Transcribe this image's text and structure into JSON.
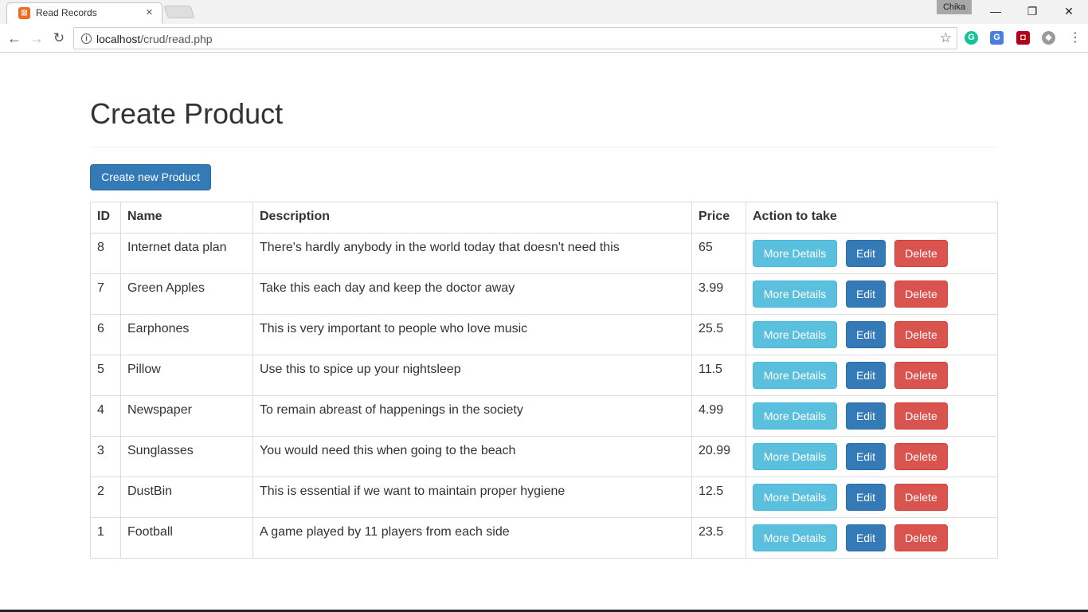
{
  "browser": {
    "tab_title": "Read Records",
    "tab_close": "×",
    "profile_name": "Chika",
    "url_host": "localhost",
    "url_path": "/crud/read.php",
    "window": {
      "minimize": "—",
      "restore": "❐",
      "close": "✕"
    }
  },
  "page": {
    "title": "Create Product",
    "create_button": "Create new Product"
  },
  "table": {
    "headers": {
      "id": "ID",
      "name": "Name",
      "description": "Description",
      "price": "Price",
      "actions": "Action to take"
    },
    "actions": {
      "details": "More Details",
      "edit": "Edit",
      "delete": "Delete"
    },
    "rows": [
      {
        "id": "8",
        "name": "Internet data plan",
        "description": "There's hardly anybody in the world today that doesn't need this",
        "price": "65"
      },
      {
        "id": "7",
        "name": "Green Apples",
        "description": "Take this each day and keep the doctor away",
        "price": "3.99"
      },
      {
        "id": "6",
        "name": "Earphones",
        "description": "This is very important to people who love music",
        "price": "25.5"
      },
      {
        "id": "5",
        "name": "Pillow",
        "description": "Use this to spice up your nightsleep",
        "price": "11.5"
      },
      {
        "id": "4",
        "name": "Newspaper",
        "description": "To remain abreast of happenings in the society",
        "price": "4.99"
      },
      {
        "id": "3",
        "name": "Sunglasses",
        "description": "You would need this when going to the beach",
        "price": "20.99"
      },
      {
        "id": "2",
        "name": "DustBin",
        "description": "This is essential if we want to maintain proper hygiene",
        "price": "12.5"
      },
      {
        "id": "1",
        "name": "Football",
        "description": "A game played by 11 players from each side",
        "price": "23.5"
      }
    ]
  },
  "colors": {
    "primary": "#337ab7",
    "info": "#5bc0de",
    "danger": "#d9534f"
  },
  "icons": [
    "back-arrow-icon",
    "forward-arrow-icon",
    "reload-icon",
    "info-icon",
    "star-icon",
    "grammarly-icon",
    "translate-icon",
    "shield-icon",
    "extension-icon",
    "menu-icon"
  ]
}
